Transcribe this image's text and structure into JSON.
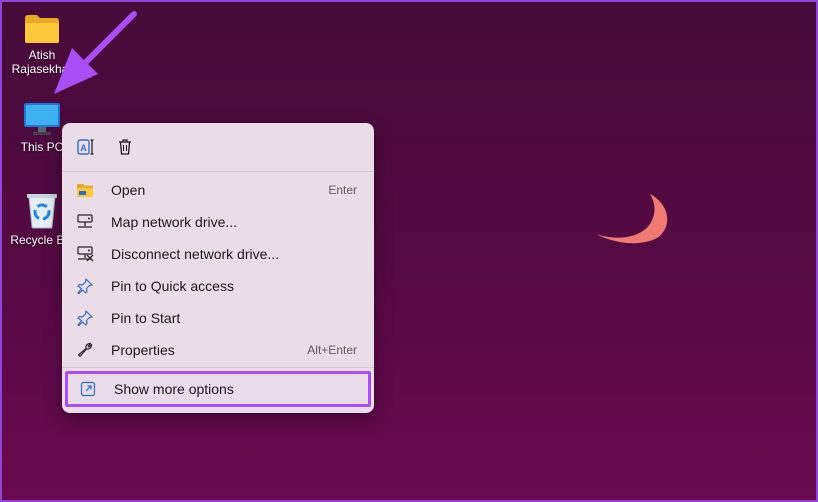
{
  "desktop": {
    "icons": [
      {
        "label_line1": "Atish",
        "label_line2": "Rajasekhar",
        "icon": "folder-icon"
      },
      {
        "label": "This PC",
        "icon": "monitor-icon"
      },
      {
        "label": "Recycle Bin",
        "icon": "recycle-bin-icon"
      }
    ]
  },
  "context_menu": {
    "quick_actions": [
      {
        "name": "rename",
        "icon": "rename-icon"
      },
      {
        "name": "delete",
        "icon": "trash-icon"
      }
    ],
    "items": [
      {
        "label": "Open",
        "shortcut": "Enter",
        "icon": "folder-open-icon"
      },
      {
        "label": "Map network drive...",
        "shortcut": "",
        "icon": "network-drive-icon"
      },
      {
        "label": "Disconnect network drive...",
        "shortcut": "",
        "icon": "disconnect-drive-icon"
      },
      {
        "label": "Pin to Quick access",
        "shortcut": "",
        "icon": "pin-icon"
      },
      {
        "label": "Pin to Start",
        "shortcut": "",
        "icon": "pin-icon"
      },
      {
        "label": "Properties",
        "shortcut": "Alt+Enter",
        "icon": "wrench-icon"
      }
    ],
    "more_options": {
      "label": "Show more options",
      "icon": "expand-icon"
    }
  },
  "colors": {
    "highlight_border": "#a94ef4",
    "annotation_arrow": "#a94ef4",
    "menu_background": "#ebdde8",
    "desktop_top": "#470a3a",
    "desktop_bottom": "#6b0a4f",
    "moon": "#f07a72"
  }
}
